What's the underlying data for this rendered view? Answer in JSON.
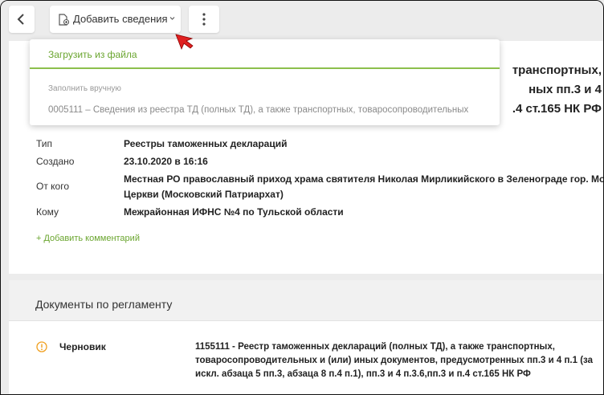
{
  "toolbar": {
    "add_label": "Добавить сведения"
  },
  "document": {
    "title_lines": [
      "транспортных,",
      "ных пп.3 и 4",
      ".4 ст.165 НК РФ"
    ],
    "fields": [
      {
        "label": "Тип",
        "value": "Реестры таможенных деклараций"
      },
      {
        "label": "Создано",
        "value": "23.10.2020 в 16:16"
      },
      {
        "label": "От кого",
        "value": "Местная РО православный приход храма святителя Николая Мирликийского в Зеленограде гор. Мо",
        "value2": "Церкви (Московский Патриархат)"
      },
      {
        "label": "Кому",
        "value": "Межрайонная ИФНС №4 по Тульской области"
      }
    ],
    "add_comment": "+ Добавить комментарий"
  },
  "regulations": {
    "title": "Документы по регламенту",
    "status": "Черновик",
    "doc_title": "1155111 - Реестр таможенных деклараций (полных ТД), а также транспортных, товаросопроводительных и (или) иных документов, предусмотренных пп.3 и 4 п.1 (за искл. абзаца 5 пп.3, абзаца 8 п.4 п.1), пп.3 и 4 п.3.6,пп.3 и п.4 ст.165 НК РФ"
  },
  "dropdown": {
    "upload_label": "Загрузить из файла",
    "manual_caption": "Заполнить вручную",
    "manual_item": "0005111 – Сведения из реестра ТД (полных ТД), а также транспортных, товаросопроводительных"
  },
  "colors": {
    "accent_green": "#6aa52f",
    "divider_green": "#8cbf4c",
    "warning_orange": "#f0a020",
    "cursor_red": "#e02020"
  },
  "icons": [
    "back-arrow-icon",
    "document-add-icon",
    "chevron-down-icon",
    "more-vertical-icon",
    "warning-circle-icon",
    "mouse-cursor-icon"
  ]
}
